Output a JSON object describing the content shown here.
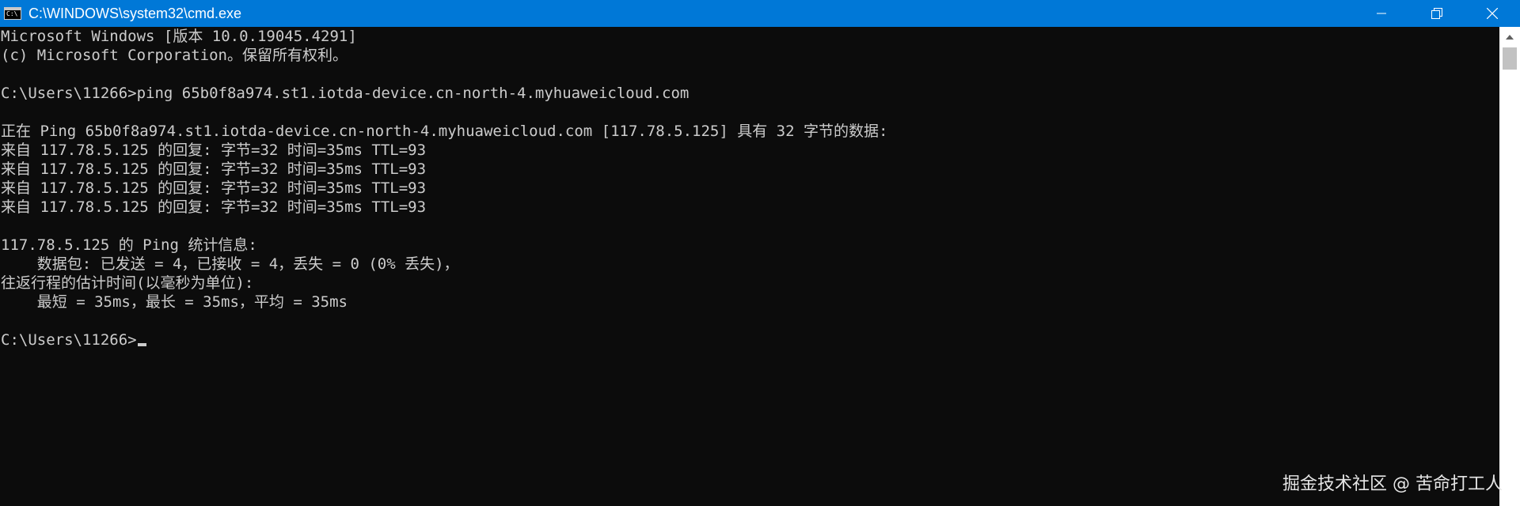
{
  "window": {
    "title": "C:\\WINDOWS\\system32\\cmd.exe",
    "icon_text": "C:\\",
    "colors": {
      "titlebar": "#0078d7",
      "console_bg": "#0c0c0c",
      "console_fg": "#cccccc"
    }
  },
  "controls": {
    "minimize": "minimize-icon",
    "maximize": "restore-icon",
    "close": "close-icon"
  },
  "console": {
    "lines": [
      "Microsoft Windows [版本 10.0.19045.4291]",
      "(c) Microsoft Corporation。保留所有权利。",
      "",
      "C:\\Users\\11266>ping 65b0f8a974.st1.iotda-device.cn-north-4.myhuaweicloud.com",
      "",
      "正在 Ping 65b0f8a974.st1.iotda-device.cn-north-4.myhuaweicloud.com [117.78.5.125] 具有 32 字节的数据:",
      "来自 117.78.5.125 的回复: 字节=32 时间=35ms TTL=93",
      "来自 117.78.5.125 的回复: 字节=32 时间=35ms TTL=93",
      "来自 117.78.5.125 的回复: 字节=32 时间=35ms TTL=93",
      "来自 117.78.5.125 的回复: 字节=32 时间=35ms TTL=93",
      "",
      "117.78.5.125 的 Ping 统计信息:",
      "    数据包: 已发送 = 4，已接收 = 4，丢失 = 0 (0% 丢失)，",
      "往返行程的估计时间(以毫秒为单位):",
      "    最短 = 35ms，最长 = 35ms，平均 = 35ms",
      "",
      "C:\\Users\\11266>"
    ]
  },
  "watermark": "掘金技术社区 @ 苦命打工人"
}
